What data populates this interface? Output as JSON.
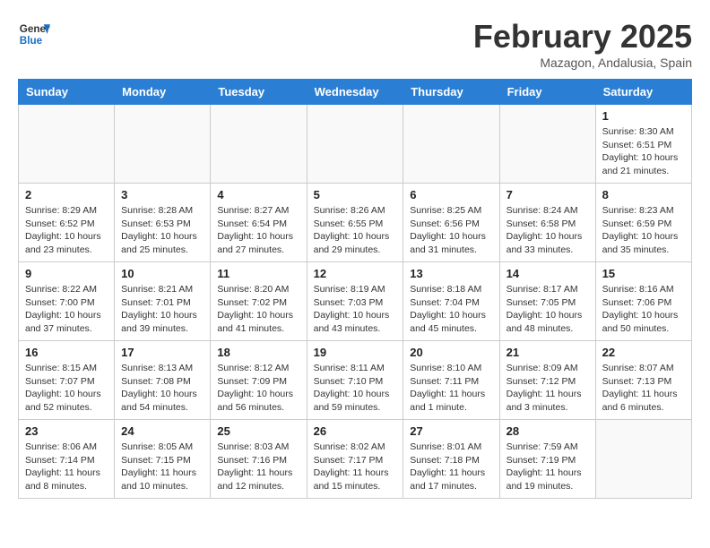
{
  "header": {
    "logo_line1": "General",
    "logo_line2": "Blue",
    "month": "February 2025",
    "location": "Mazagon, Andalusia, Spain"
  },
  "weekdays": [
    "Sunday",
    "Monday",
    "Tuesday",
    "Wednesday",
    "Thursday",
    "Friday",
    "Saturday"
  ],
  "weeks": [
    [
      {
        "day": "",
        "info": ""
      },
      {
        "day": "",
        "info": ""
      },
      {
        "day": "",
        "info": ""
      },
      {
        "day": "",
        "info": ""
      },
      {
        "day": "",
        "info": ""
      },
      {
        "day": "",
        "info": ""
      },
      {
        "day": "1",
        "info": "Sunrise: 8:30 AM\nSunset: 6:51 PM\nDaylight: 10 hours\nand 21 minutes."
      }
    ],
    [
      {
        "day": "2",
        "info": "Sunrise: 8:29 AM\nSunset: 6:52 PM\nDaylight: 10 hours\nand 23 minutes."
      },
      {
        "day": "3",
        "info": "Sunrise: 8:28 AM\nSunset: 6:53 PM\nDaylight: 10 hours\nand 25 minutes."
      },
      {
        "day": "4",
        "info": "Sunrise: 8:27 AM\nSunset: 6:54 PM\nDaylight: 10 hours\nand 27 minutes."
      },
      {
        "day": "5",
        "info": "Sunrise: 8:26 AM\nSunset: 6:55 PM\nDaylight: 10 hours\nand 29 minutes."
      },
      {
        "day": "6",
        "info": "Sunrise: 8:25 AM\nSunset: 6:56 PM\nDaylight: 10 hours\nand 31 minutes."
      },
      {
        "day": "7",
        "info": "Sunrise: 8:24 AM\nSunset: 6:58 PM\nDaylight: 10 hours\nand 33 minutes."
      },
      {
        "day": "8",
        "info": "Sunrise: 8:23 AM\nSunset: 6:59 PM\nDaylight: 10 hours\nand 35 minutes."
      }
    ],
    [
      {
        "day": "9",
        "info": "Sunrise: 8:22 AM\nSunset: 7:00 PM\nDaylight: 10 hours\nand 37 minutes."
      },
      {
        "day": "10",
        "info": "Sunrise: 8:21 AM\nSunset: 7:01 PM\nDaylight: 10 hours\nand 39 minutes."
      },
      {
        "day": "11",
        "info": "Sunrise: 8:20 AM\nSunset: 7:02 PM\nDaylight: 10 hours\nand 41 minutes."
      },
      {
        "day": "12",
        "info": "Sunrise: 8:19 AM\nSunset: 7:03 PM\nDaylight: 10 hours\nand 43 minutes."
      },
      {
        "day": "13",
        "info": "Sunrise: 8:18 AM\nSunset: 7:04 PM\nDaylight: 10 hours\nand 45 minutes."
      },
      {
        "day": "14",
        "info": "Sunrise: 8:17 AM\nSunset: 7:05 PM\nDaylight: 10 hours\nand 48 minutes."
      },
      {
        "day": "15",
        "info": "Sunrise: 8:16 AM\nSunset: 7:06 PM\nDaylight: 10 hours\nand 50 minutes."
      }
    ],
    [
      {
        "day": "16",
        "info": "Sunrise: 8:15 AM\nSunset: 7:07 PM\nDaylight: 10 hours\nand 52 minutes."
      },
      {
        "day": "17",
        "info": "Sunrise: 8:13 AM\nSunset: 7:08 PM\nDaylight: 10 hours\nand 54 minutes."
      },
      {
        "day": "18",
        "info": "Sunrise: 8:12 AM\nSunset: 7:09 PM\nDaylight: 10 hours\nand 56 minutes."
      },
      {
        "day": "19",
        "info": "Sunrise: 8:11 AM\nSunset: 7:10 PM\nDaylight: 10 hours\nand 59 minutes."
      },
      {
        "day": "20",
        "info": "Sunrise: 8:10 AM\nSunset: 7:11 PM\nDaylight: 11 hours\nand 1 minute."
      },
      {
        "day": "21",
        "info": "Sunrise: 8:09 AM\nSunset: 7:12 PM\nDaylight: 11 hours\nand 3 minutes."
      },
      {
        "day": "22",
        "info": "Sunrise: 8:07 AM\nSunset: 7:13 PM\nDaylight: 11 hours\nand 6 minutes."
      }
    ],
    [
      {
        "day": "23",
        "info": "Sunrise: 8:06 AM\nSunset: 7:14 PM\nDaylight: 11 hours\nand 8 minutes."
      },
      {
        "day": "24",
        "info": "Sunrise: 8:05 AM\nSunset: 7:15 PM\nDaylight: 11 hours\nand 10 minutes."
      },
      {
        "day": "25",
        "info": "Sunrise: 8:03 AM\nSunset: 7:16 PM\nDaylight: 11 hours\nand 12 minutes."
      },
      {
        "day": "26",
        "info": "Sunrise: 8:02 AM\nSunset: 7:17 PM\nDaylight: 11 hours\nand 15 minutes."
      },
      {
        "day": "27",
        "info": "Sunrise: 8:01 AM\nSunset: 7:18 PM\nDaylight: 11 hours\nand 17 minutes."
      },
      {
        "day": "28",
        "info": "Sunrise: 7:59 AM\nSunset: 7:19 PM\nDaylight: 11 hours\nand 19 minutes."
      },
      {
        "day": "",
        "info": ""
      }
    ]
  ]
}
